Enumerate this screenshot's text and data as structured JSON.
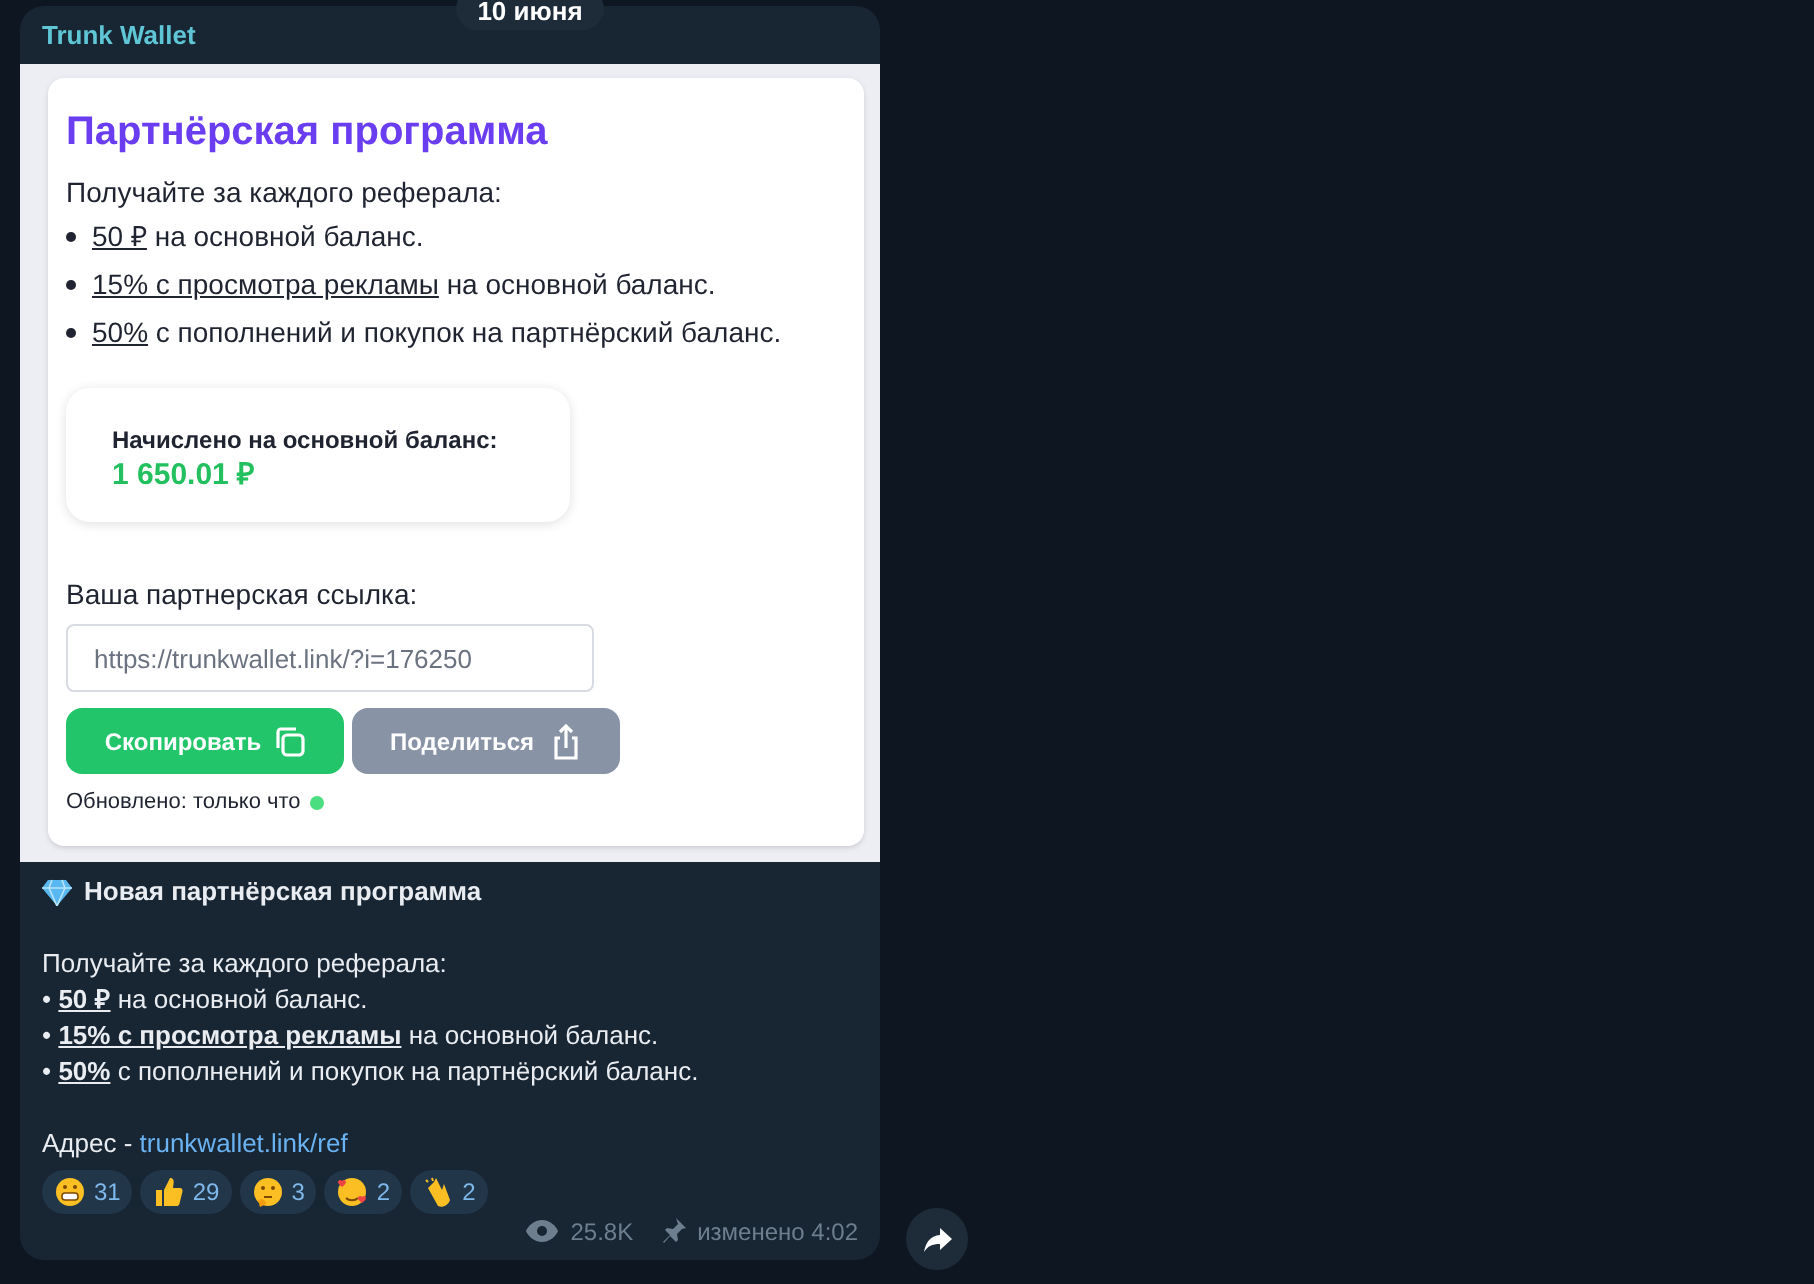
{
  "date_badge": "10 июня",
  "message": {
    "sender": "Trunk Wallet",
    "image": {
      "title": "Партнёрская программа",
      "intro": "Получайте за каждого реферала:",
      "bullets": [
        {
          "underlined": "50 ₽",
          "rest": " на основной баланс."
        },
        {
          "underlined": "15% с просмотра рекламы",
          "rest": " на основной баланс."
        },
        {
          "underlined": "50%",
          "rest": " с пополнений и покупок на партнёрский баланс."
        }
      ],
      "balance": {
        "label": "Начислено на основной баланс:",
        "value": "1 650.01 ₽"
      },
      "link_label": "Ваша партнерская ссылка:",
      "link_field": {
        "value": "https://trunkwallet.link/?i=176250"
      },
      "buttons": [
        {
          "label": "Скопировать",
          "kind": "copy"
        },
        {
          "label": "Поделиться",
          "kind": "share"
        }
      ],
      "updated": {
        "text": "Обновлено: только что",
        "color": "#4ade80"
      }
    },
    "caption": {
      "title": "Новая партнёрская программа",
      "intro": "Получайте за каждого реферала:",
      "bullets": [
        {
          "bullet": "•",
          "underlined": "50 ₽",
          "rest": " на основной баланс."
        },
        {
          "bullet": "•",
          "underlined": "15% с просмотра рекламы",
          "rest": " на основной баланс."
        },
        {
          "bullet": "•",
          "underlined": "50%",
          "rest": " с пополнений и покупок на партнёрский баланс."
        }
      ],
      "address_label": "Адрес - ",
      "address_link": "trunkwallet.link/ref"
    },
    "reactions": [
      {
        "kind": "grin",
        "count": "31"
      },
      {
        "kind": "thumbs",
        "count": "29"
      },
      {
        "kind": "thinking",
        "count": "3"
      },
      {
        "kind": "hearts",
        "count": "2"
      },
      {
        "kind": "clap",
        "count": "2"
      }
    ],
    "views": "25.8K",
    "edited": "изменено 4:02"
  }
}
